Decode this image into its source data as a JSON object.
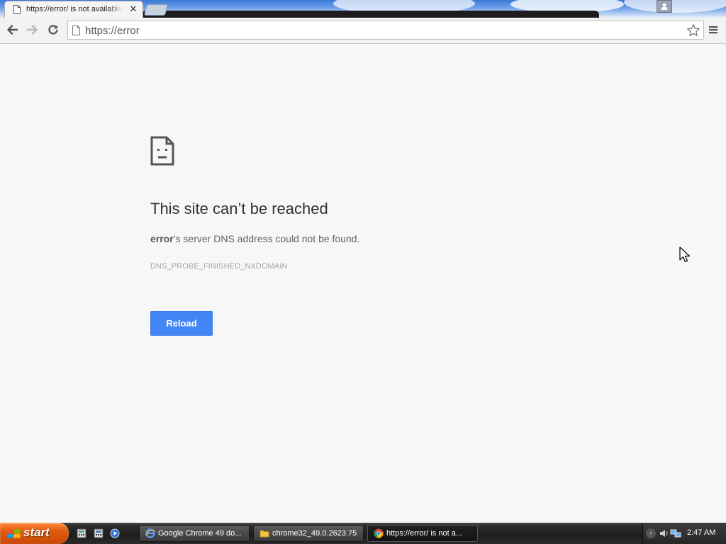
{
  "browser": {
    "tab": {
      "title": "https://error/ is not available"
    },
    "toolbar": {
      "url": "https://error"
    }
  },
  "error_page": {
    "heading": "This site can’t be reached",
    "description_host": "error",
    "description_rest": "’s server DNS address could not be found.",
    "error_code": "DNS_PROBE_FINISHED_NXDOMAIN",
    "reload_label": "Reload"
  },
  "taskbar": {
    "start_label": "start",
    "tasks": [
      {
        "label": "Google Chrome 49 do...",
        "icon": "ie-icon"
      },
      {
        "label": "chrome32_49.0.2623.75",
        "icon": "folder-icon"
      },
      {
        "label": "https://error/ is not a...",
        "icon": "chrome-icon"
      }
    ],
    "clock": "2:47 AM"
  },
  "colors": {
    "accent_button": "#4285f4",
    "page_background": "#f7f7f7",
    "start_button": "#e05a10"
  }
}
